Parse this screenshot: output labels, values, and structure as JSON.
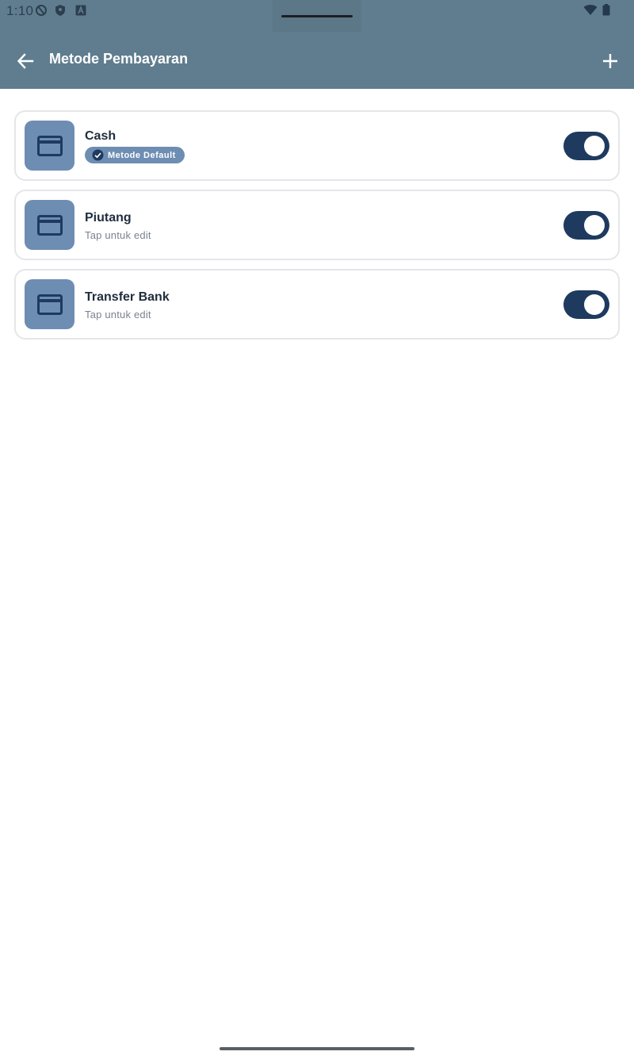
{
  "status_bar": {
    "time": "1:10",
    "icons": [
      "data-saver-icon",
      "shield-icon",
      "font-a-icon",
      "wifi-icon",
      "battery-icon"
    ]
  },
  "header": {
    "title": "Metode Pembayaran",
    "back_icon": "arrow-left-icon",
    "add_icon": "plus-icon",
    "background_color": "#607d8f"
  },
  "payment_methods": [
    {
      "name": "Cash",
      "badge": "Metode Default",
      "subtitle": "",
      "enabled": true,
      "icon": "credit-card-icon"
    },
    {
      "name": "Piutang",
      "badge": "",
      "subtitle": "Tap untuk edit",
      "enabled": true,
      "icon": "credit-card-icon"
    },
    {
      "name": "Transfer Bank",
      "badge": "",
      "subtitle": "Tap untuk edit",
      "enabled": true,
      "icon": "credit-card-icon"
    }
  ],
  "colors": {
    "accent": "#1e3a5f",
    "icon_tile": "#6e8db3"
  }
}
